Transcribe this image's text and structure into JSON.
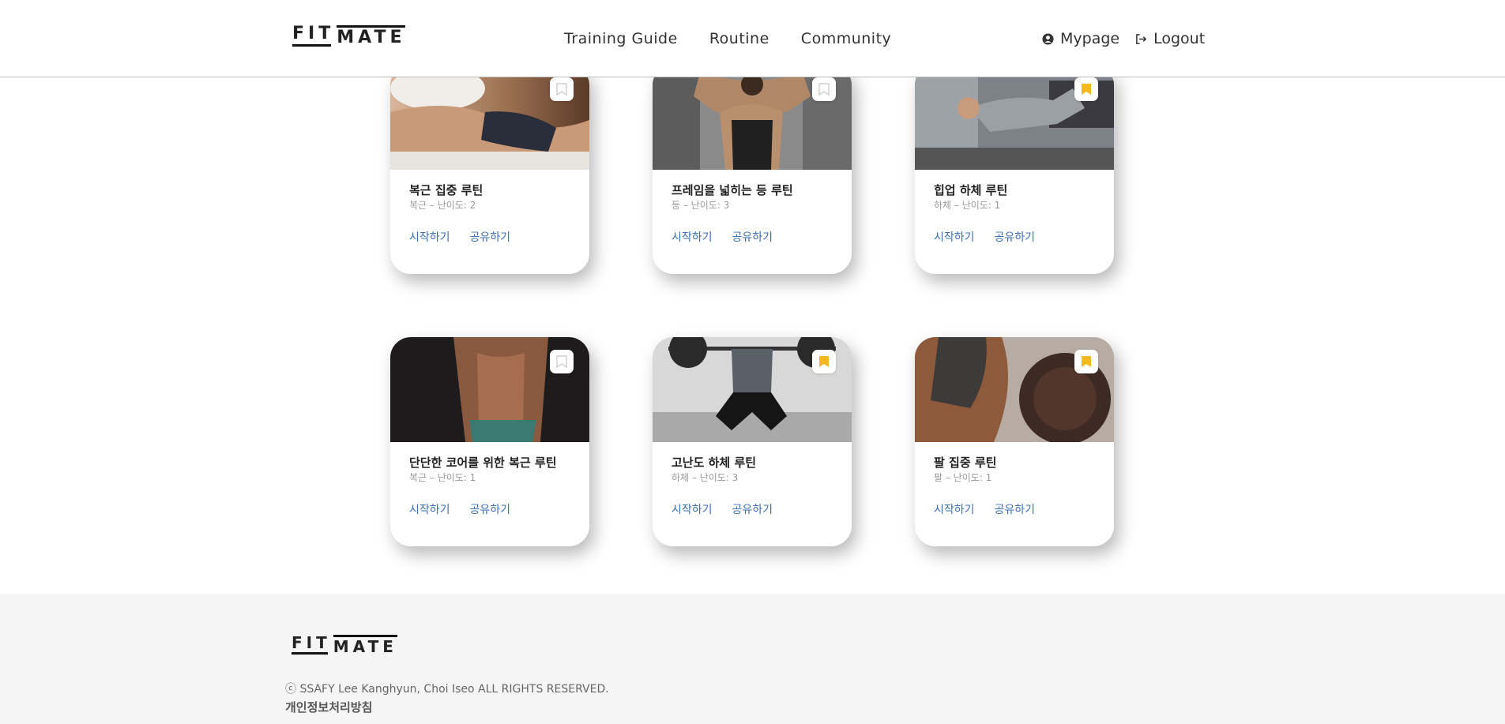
{
  "header": {
    "logo_top": "FIT",
    "logo_bottom": "MATE",
    "nav": [
      "Training Guide",
      "Routine",
      "Community"
    ],
    "mypage_label": "Mypage",
    "logout_label": "Logout"
  },
  "routines": [
    {
      "title": "복근 집중 루틴",
      "meta": "복근 – 난이도: 2",
      "bookmarked": false,
      "start_label": "시작하기",
      "share_label": "공유하기"
    },
    {
      "title": "프레임을 넓히는 등 루틴",
      "meta": "등 – 난이도: 3",
      "bookmarked": false,
      "start_label": "시작하기",
      "share_label": "공유하기"
    },
    {
      "title": "힙업 하체 루틴",
      "meta": "하체 – 난이도: 1",
      "bookmarked": true,
      "start_label": "시작하기",
      "share_label": "공유하기"
    },
    {
      "title": "단단한 코어를 위한 복근 루틴",
      "meta": "복근 – 난이도: 1",
      "bookmarked": false,
      "start_label": "시작하기",
      "share_label": "공유하기"
    },
    {
      "title": "고난도 하체 루틴",
      "meta": "하체 – 난이도: 3",
      "bookmarked": true,
      "start_label": "시작하기",
      "share_label": "공유하기"
    },
    {
      "title": "팔 집중 루틴",
      "meta": "팔 – 난이도: 1",
      "bookmarked": true,
      "start_label": "시작하기",
      "share_label": "공유하기"
    }
  ],
  "footer": {
    "logo_top": "FIT",
    "logo_bottom": "MATE",
    "copyright": "ⓒ SSAFY Lee Kanghyun, Choi Iseo ALL RIGHTS RESERVED.",
    "privacy_label": "개인정보처리방침"
  },
  "colors": {
    "link": "#3a6fb0",
    "bookmark_active": "#f5b820",
    "bookmark_inactive": "#d0d0d0"
  }
}
